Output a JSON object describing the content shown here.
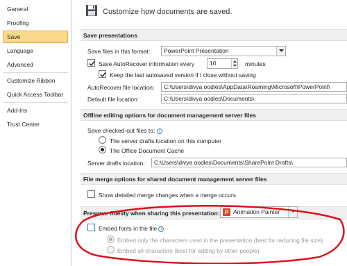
{
  "sidebar": {
    "items": [
      {
        "label": "General"
      },
      {
        "label": "Proofing"
      },
      {
        "label": "Save"
      },
      {
        "label": "Language"
      },
      {
        "label": "Advanced"
      },
      {
        "label": "Customize Ribbon"
      },
      {
        "label": "Quick Access Toolbar"
      },
      {
        "label": "Add-Ins"
      },
      {
        "label": "Trust Center"
      }
    ],
    "active": "Save"
  },
  "header": {
    "title": "Customize how documents are saved."
  },
  "save_presentations": {
    "section_title": "Save presentations",
    "format_label": "Save files in this format:",
    "format_value": "PowerPoint Presentation",
    "autorecover_label": "Save AutoRecover information every",
    "autorecover_value": "10",
    "autorecover_unit": "minutes",
    "autorecover_checked": true,
    "keep_last_label": "Keep the last autosaved version if I close without saving",
    "keep_last_checked": true,
    "autorecover_location_label": "AutoRecover file location:",
    "autorecover_location_value": "C:\\Users\\divya oodles\\AppData\\Roaming\\Microsoft\\PowerPoint\\",
    "default_location_label": "Default file location:",
    "default_location_value": "C:\\Users\\divya oodles\\Documents\\"
  },
  "offline_editing": {
    "section_title": "Offline editing options for document management server files",
    "checked_out_label": "Save checked-out files to:",
    "option_server_drafts": "The server drafts location on this computer",
    "option_office_cache": "The Office Document Cache",
    "selected": "The Office Document Cache",
    "server_drafts_label": "Server drafts location:",
    "server_drafts_value": "C:\\Users\\divya oodles\\Documents\\SharePoint Drafts\\"
  },
  "file_merge": {
    "section_title": "File merge options for shared document management server files",
    "show_merge_label": "Show detailed merge changes when a merge occurs",
    "show_merge_checked": false
  },
  "preserve_fidelity": {
    "section_title": "Preserve fidelity when sharing this presentation:",
    "presentation_value": "Animation Painter",
    "embed_fonts_label": "Embed fonts in the file",
    "embed_fonts_checked": false,
    "embed_only_used_label": "Embed only the characters used in the presentation (best for reducing file size)",
    "embed_all_label": "Embed all characters (best for editing by other people)",
    "embed_selected": "Embed only the characters used in the presentation (best for reducing file size)"
  },
  "colors": {
    "active_item_bg": "#fbd98a",
    "active_item_border": "#e5a94a",
    "annotation_red": "#e0101a",
    "info_blue": "#3c7fb1"
  }
}
